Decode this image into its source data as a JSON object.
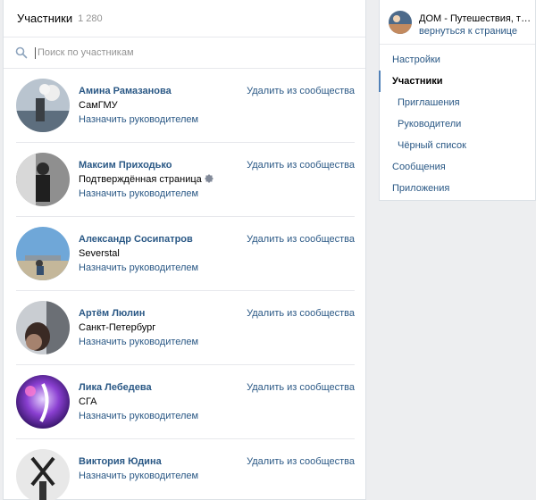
{
  "header": {
    "title": "Участники",
    "count": "1 280"
  },
  "search": {
    "placeholder": "Поиск по участникам"
  },
  "members": [
    {
      "name": "Амина Рамазанова",
      "subtitle": "СамГМУ",
      "assign": "Назначить руководителем",
      "remove": "Удалить из сообщества"
    },
    {
      "name": "Максим Приходько",
      "subtitle": "Подтверждённая страница",
      "assign": "Назначить руководителем",
      "remove": "Удалить из сообщества"
    },
    {
      "name": "Александр Сосипатров",
      "subtitle": "Severstal",
      "assign": "Назначить руководителем",
      "remove": "Удалить из сообщества"
    },
    {
      "name": "Артём Люлин",
      "subtitle": "Санкт-Петербург",
      "assign": "Назначить руководителем",
      "remove": "Удалить из сообщества"
    },
    {
      "name": "Лика Лебедева",
      "subtitle": "СГА",
      "assign": "Назначить руководителем",
      "remove": "Удалить из сообщества"
    },
    {
      "name": "Виктория Юдина",
      "subtitle": "",
      "assign": "Назначить руководителем",
      "remove": "Удалить из сообщества"
    }
  ],
  "sidebar": {
    "group_name": "ДОМ - Путешествия, туризм",
    "back_link": "вернуться к странице",
    "menu": [
      {
        "label": "Настройки"
      },
      {
        "label": "Участники"
      },
      {
        "label": "Приглашения"
      },
      {
        "label": "Руководители"
      },
      {
        "label": "Чёрный список"
      },
      {
        "label": "Сообщения"
      },
      {
        "label": "Приложения"
      }
    ]
  },
  "colors": {
    "link": "#2a5885",
    "active_marker": "#5181b8",
    "background": "#edeef0"
  }
}
